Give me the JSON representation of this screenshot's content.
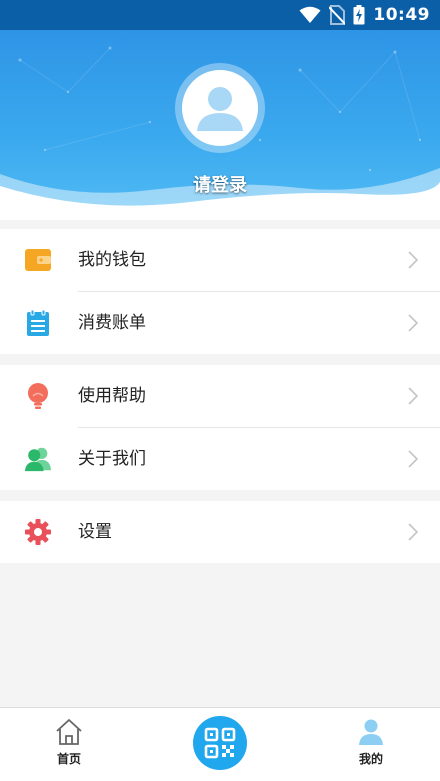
{
  "status_bar": {
    "time": "10:49"
  },
  "profile": {
    "login_text": "请登录"
  },
  "menu_groups": [
    [
      {
        "label": "我的钱包",
        "icon": "wallet-icon"
      },
      {
        "label": "消费账单",
        "icon": "bill-icon"
      }
    ],
    [
      {
        "label": "使用帮助",
        "icon": "lightbulb-icon"
      },
      {
        "label": "关于我们",
        "icon": "users-icon"
      }
    ],
    [
      {
        "label": "设置",
        "icon": "gear-icon"
      }
    ]
  ],
  "bottom_nav": {
    "home_label": "首页",
    "mine_label": "我的",
    "scan_icon": "qr-code-icon"
  },
  "colors": {
    "header_blue": "#2e95e6",
    "accent_blue": "#21a7ee",
    "wallet": "#f5a623",
    "bill": "#29a8e6",
    "help": "#f26d5b",
    "about": "#2bb86a",
    "settings": "#e9505a"
  }
}
